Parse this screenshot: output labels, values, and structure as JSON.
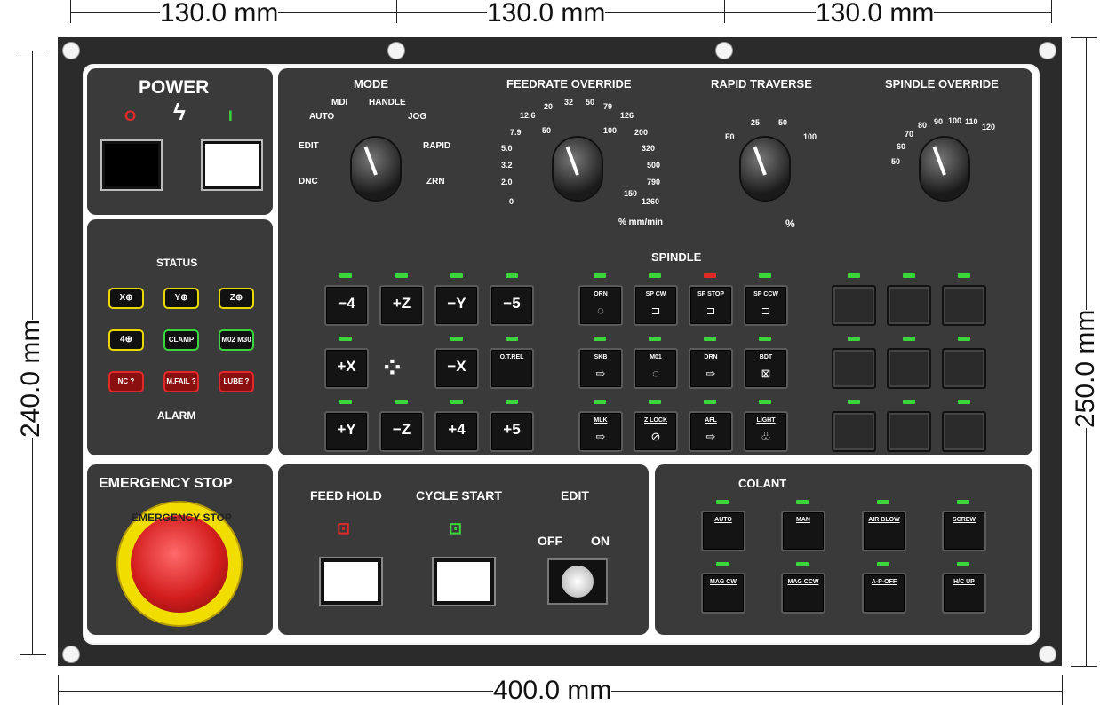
{
  "dimensions": {
    "top1": "130.0 mm",
    "top2": "130.0 mm",
    "top3": "130.0 mm",
    "bottom": "400.0 mm",
    "left": "240.0 mm",
    "right": "250.0 mm"
  },
  "power": {
    "title": "POWER",
    "off_symbol": "O",
    "on_symbol": "I"
  },
  "status": {
    "title": "STATUS",
    "alarm_title": "ALARM",
    "status_items": [
      "X",
      "Y",
      "Z",
      "4",
      "CLAMP",
      "M02 M30"
    ],
    "alarm_items": [
      "NC ?",
      "M.FAIL ?",
      "LUBE ?"
    ]
  },
  "mode": {
    "title": "MODE",
    "auto": "AUTO",
    "mdi": "MDI",
    "handle": "HANDLE",
    "jog": "JOG",
    "edit": "EDIT",
    "rapid": "RAPID",
    "dnc": "DNC",
    "zrn": "ZRN"
  },
  "feedrate": {
    "title": "FEEDRATE OVERRIDE",
    "left_scale": [
      "12.6",
      "7.9",
      "5.0",
      "3.2",
      "2.0",
      "0"
    ],
    "top_scale": [
      "20",
      "32",
      "50",
      "79",
      "126"
    ],
    "inner_scale": [
      "50",
      "100"
    ],
    "right_scale": [
      "200",
      "320",
      "500",
      "790",
      "1260"
    ],
    "inner_right": "150",
    "unit": "% mm/min"
  },
  "rapid": {
    "title": "RAPID TRAVERSE",
    "scale": [
      "F0",
      "25",
      "50",
      "100"
    ],
    "unit": "%"
  },
  "spindle_override": {
    "title": "SPINDLE OVERRIDE",
    "scale": [
      "50",
      "60",
      "70",
      "80",
      "90",
      "100",
      "110",
      "120"
    ]
  },
  "axis_keys": {
    "row1": [
      "−4",
      "+Z",
      "−Y",
      "−5"
    ],
    "row2": [
      "+X",
      "−X",
      "O.T.REL"
    ],
    "row3": [
      "+Y",
      "−Z",
      "+4",
      "+5"
    ]
  },
  "spindle": {
    "title": "SPINDLE",
    "row1": [
      "ORN",
      "SP CW",
      "SP STOP",
      "SP CCW"
    ],
    "row2": [
      "SKB",
      "M01",
      "DRN",
      "BDT"
    ],
    "row3": [
      "MLK",
      "Z LOCK",
      "AFL",
      "LIGHT"
    ]
  },
  "emergency": {
    "title": "EMERGENCY STOP",
    "ring_text": "EMERGENCY STOP"
  },
  "controls": {
    "feed_hold": "FEED HOLD",
    "cycle_start": "CYCLE START",
    "edit": "EDIT",
    "off": "OFF",
    "on": "ON"
  },
  "coolant": {
    "title": "COLANT",
    "row1": [
      "AUTO",
      "MAN",
      "AIR BLOW",
      "SCREW"
    ],
    "row2": [
      "MAG CW",
      "MAG CCW",
      "A-P-OFF",
      "H/C UP"
    ]
  }
}
